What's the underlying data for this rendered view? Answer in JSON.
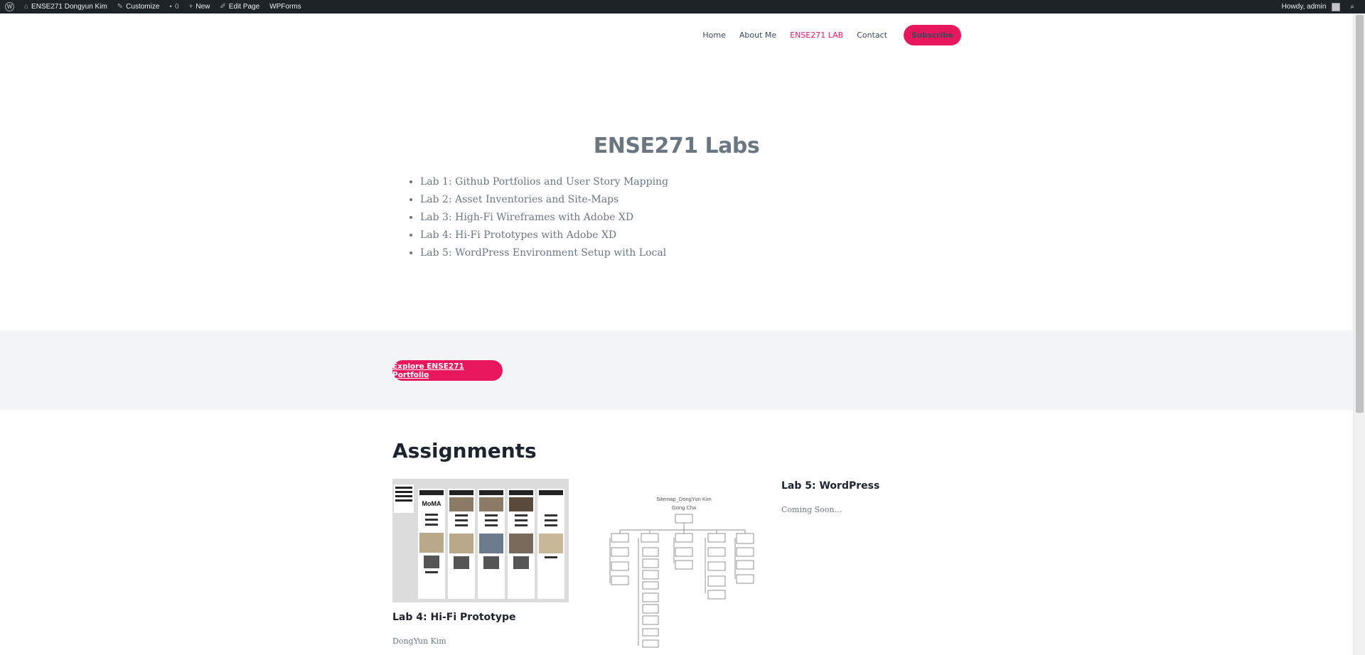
{
  "admin_bar": {
    "site_name": "ENSE271 Dongyun Kim",
    "customize": "Customize",
    "comments_count": "0",
    "new": "New",
    "edit_page": "Edit Page",
    "wpforms": "WPForms",
    "greeting": "Howdy, admin"
  },
  "nav": {
    "items": [
      {
        "label": "Home"
      },
      {
        "label": "About Me"
      },
      {
        "label": "ENSE271 LAB",
        "active": true
      },
      {
        "label": "Contact"
      }
    ],
    "subscribe": "Subscribe"
  },
  "hero": {
    "title": "ENSE271 Labs",
    "labs": [
      "Lab 1: Github Portfolios and User Story Mapping",
      "Lab 2: Asset Inventories and Site-Maps",
      "Lab 3: High-Fi Wireframes with Adobe XD",
      "Lab 4: Hi-Fi Prototypes with Adobe XD",
      "Lab 5: WordPress Environment Setup with Local"
    ]
  },
  "band": {
    "explore": "Explore ENSE271 Portfolio"
  },
  "assignments": {
    "title": "Assignments",
    "cards": [
      {
        "title": "Lab 4: Hi-Fi Prototype",
        "meta": "DongYun Kim",
        "thumb_text": "MoMA"
      },
      {
        "title": "",
        "meta": "",
        "sitemap_title": "Sitemap_DongYun Kim",
        "sitemap_subtitle": "Gong Cha"
      },
      {
        "title": "Lab 5: WordPress",
        "meta": "Coming Soon…"
      }
    ]
  },
  "colors": {
    "accent": "#e8175d",
    "admin_bar": "#1d2327",
    "band": "#f3f4f6",
    "muted": "#6b7780"
  }
}
